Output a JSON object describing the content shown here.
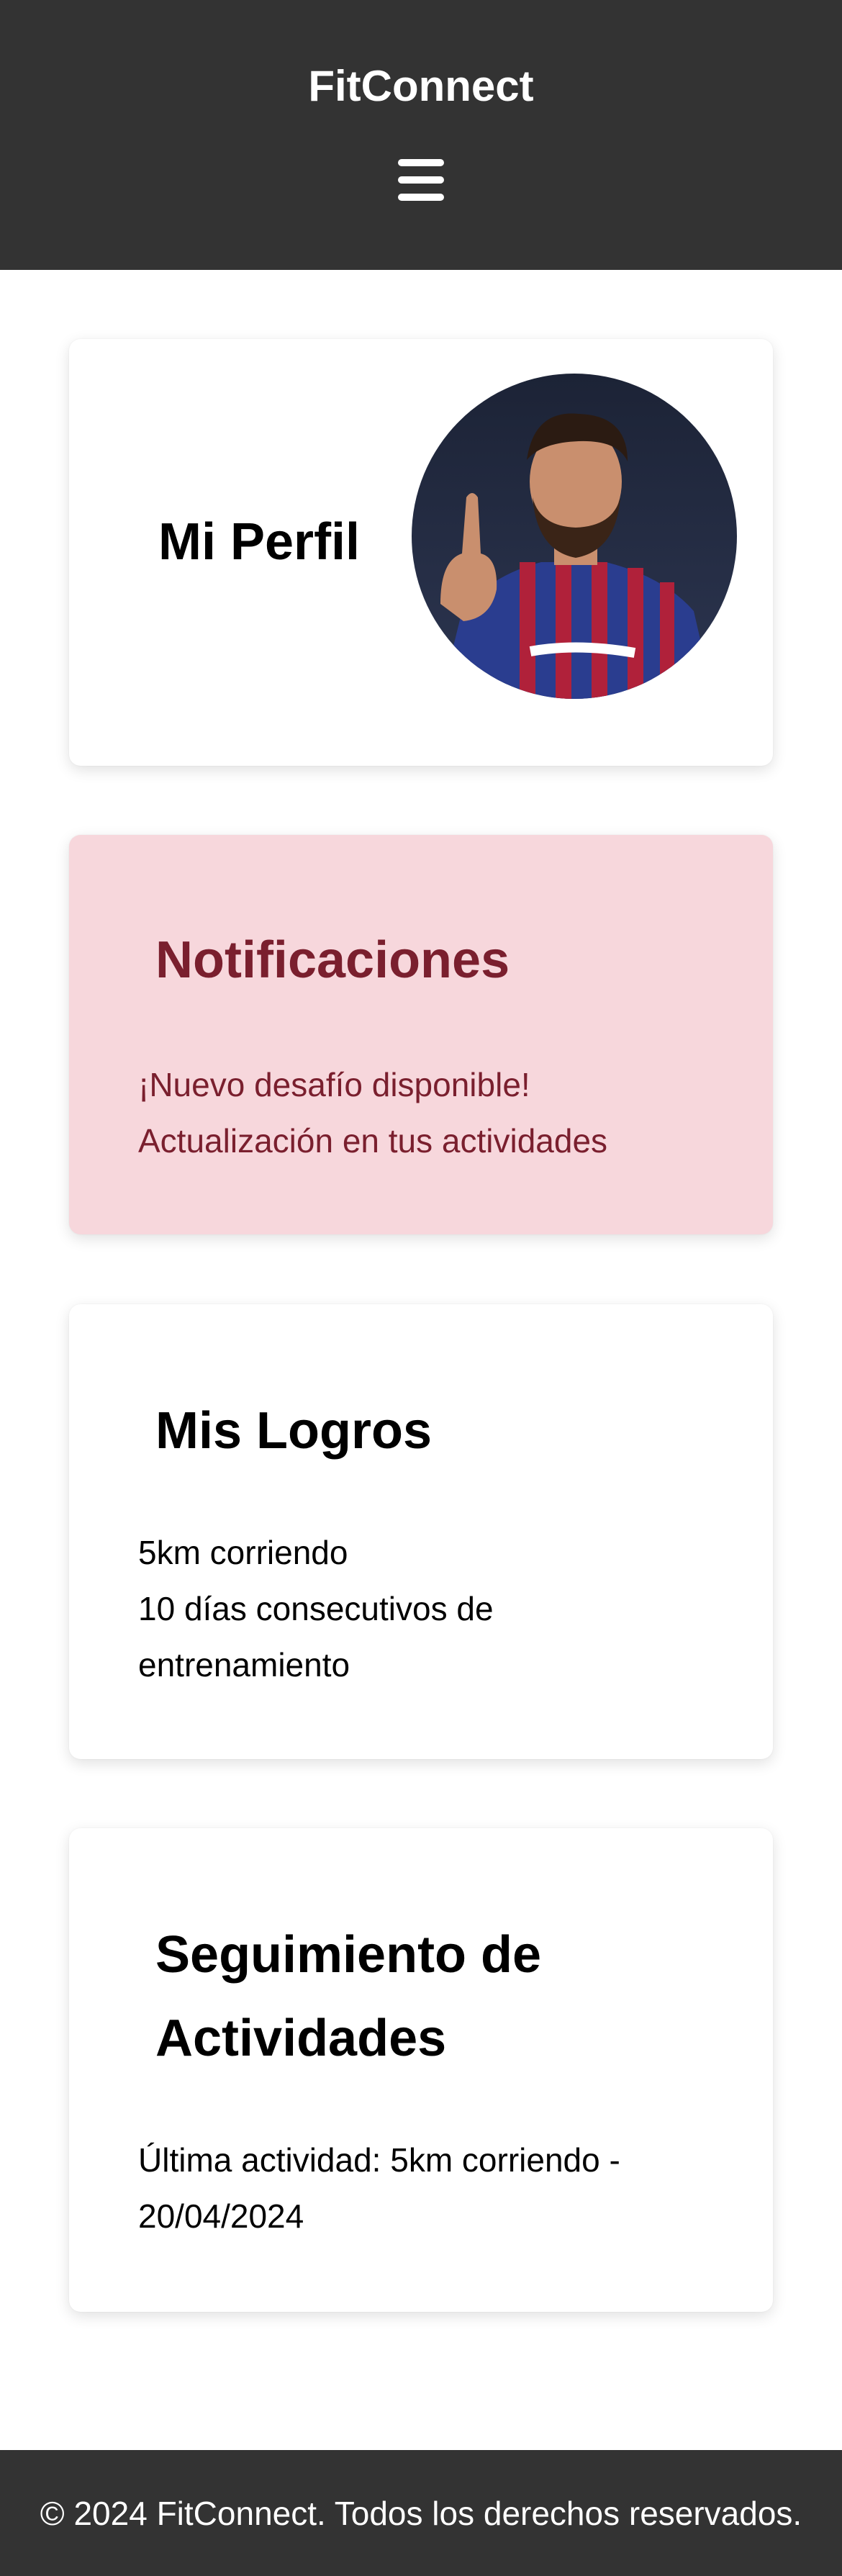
{
  "header": {
    "brand": "FitConnect",
    "menu_icon": "hamburger-icon"
  },
  "profile": {
    "title": "Mi Perfil"
  },
  "notifications": {
    "title": "Notificaciones",
    "items": [
      "¡Nuevo desafío disponible!",
      "Actualización en tus actividades"
    ]
  },
  "achievements": {
    "title": "Mis Logros",
    "items": [
      "5km corriendo",
      "10 días consecutivos de entrenamiento"
    ]
  },
  "tracking": {
    "title": "Seguimiento de Actividades",
    "last_activity": "Última actividad: 5km corriendo - 20/04/2024"
  },
  "footer": {
    "text": "© 2024 FitConnect. Todos los derechos reservados."
  },
  "colors": {
    "header_bg": "#333333",
    "notifications_bg": "#f7d7dc",
    "notifications_text": "#7a1f2e"
  }
}
